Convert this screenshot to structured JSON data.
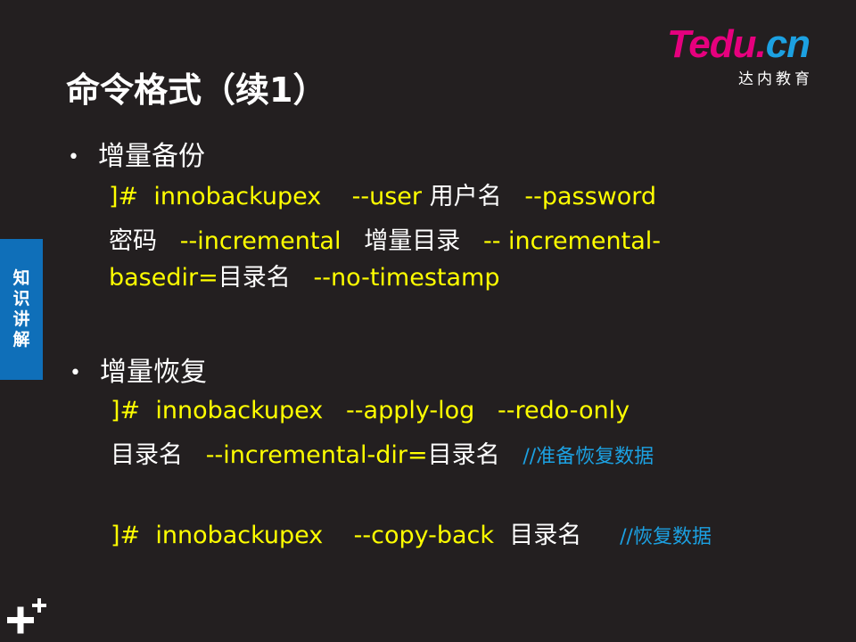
{
  "title": "命令格式（续1）",
  "logo": {
    "brand_t": "T",
    "brand_edu": "edu.",
    "brand_cn": "cn",
    "sub": "达内教育"
  },
  "side_tab": [
    "知",
    "识",
    "讲",
    "解"
  ],
  "sections": [
    {
      "heading": "增量备份",
      "lines": [
        {
          "prompt": "]#",
          "cmd": "innobackupex",
          "opt1": "--user",
          "arg1": "用户名",
          "opt2": "--password"
        },
        {
          "arg2": "密码",
          "opt3": "--incremental",
          "arg3": "增量目录",
          "opt4": "-- incremental-"
        },
        {
          "opt5": "basedir=",
          "arg4": "目录名",
          "opt6": "--no-timestamp"
        }
      ]
    },
    {
      "heading": "增量恢复",
      "lines": [
        {
          "prompt": "]#",
          "cmd": "innobackupex",
          "opt1": "--apply-log",
          "opt2": "--redo-only"
        },
        {
          "arg1": "目录名",
          "opt3": "--incremental-dir=",
          "arg2": "目录名",
          "comment": "//准备恢复数据"
        },
        {
          "prompt": "]#",
          "cmd": "innobackupex",
          "opt1": "--copy-back",
          "arg1": "目录名",
          "comment": "//恢复数据"
        }
      ]
    }
  ]
}
